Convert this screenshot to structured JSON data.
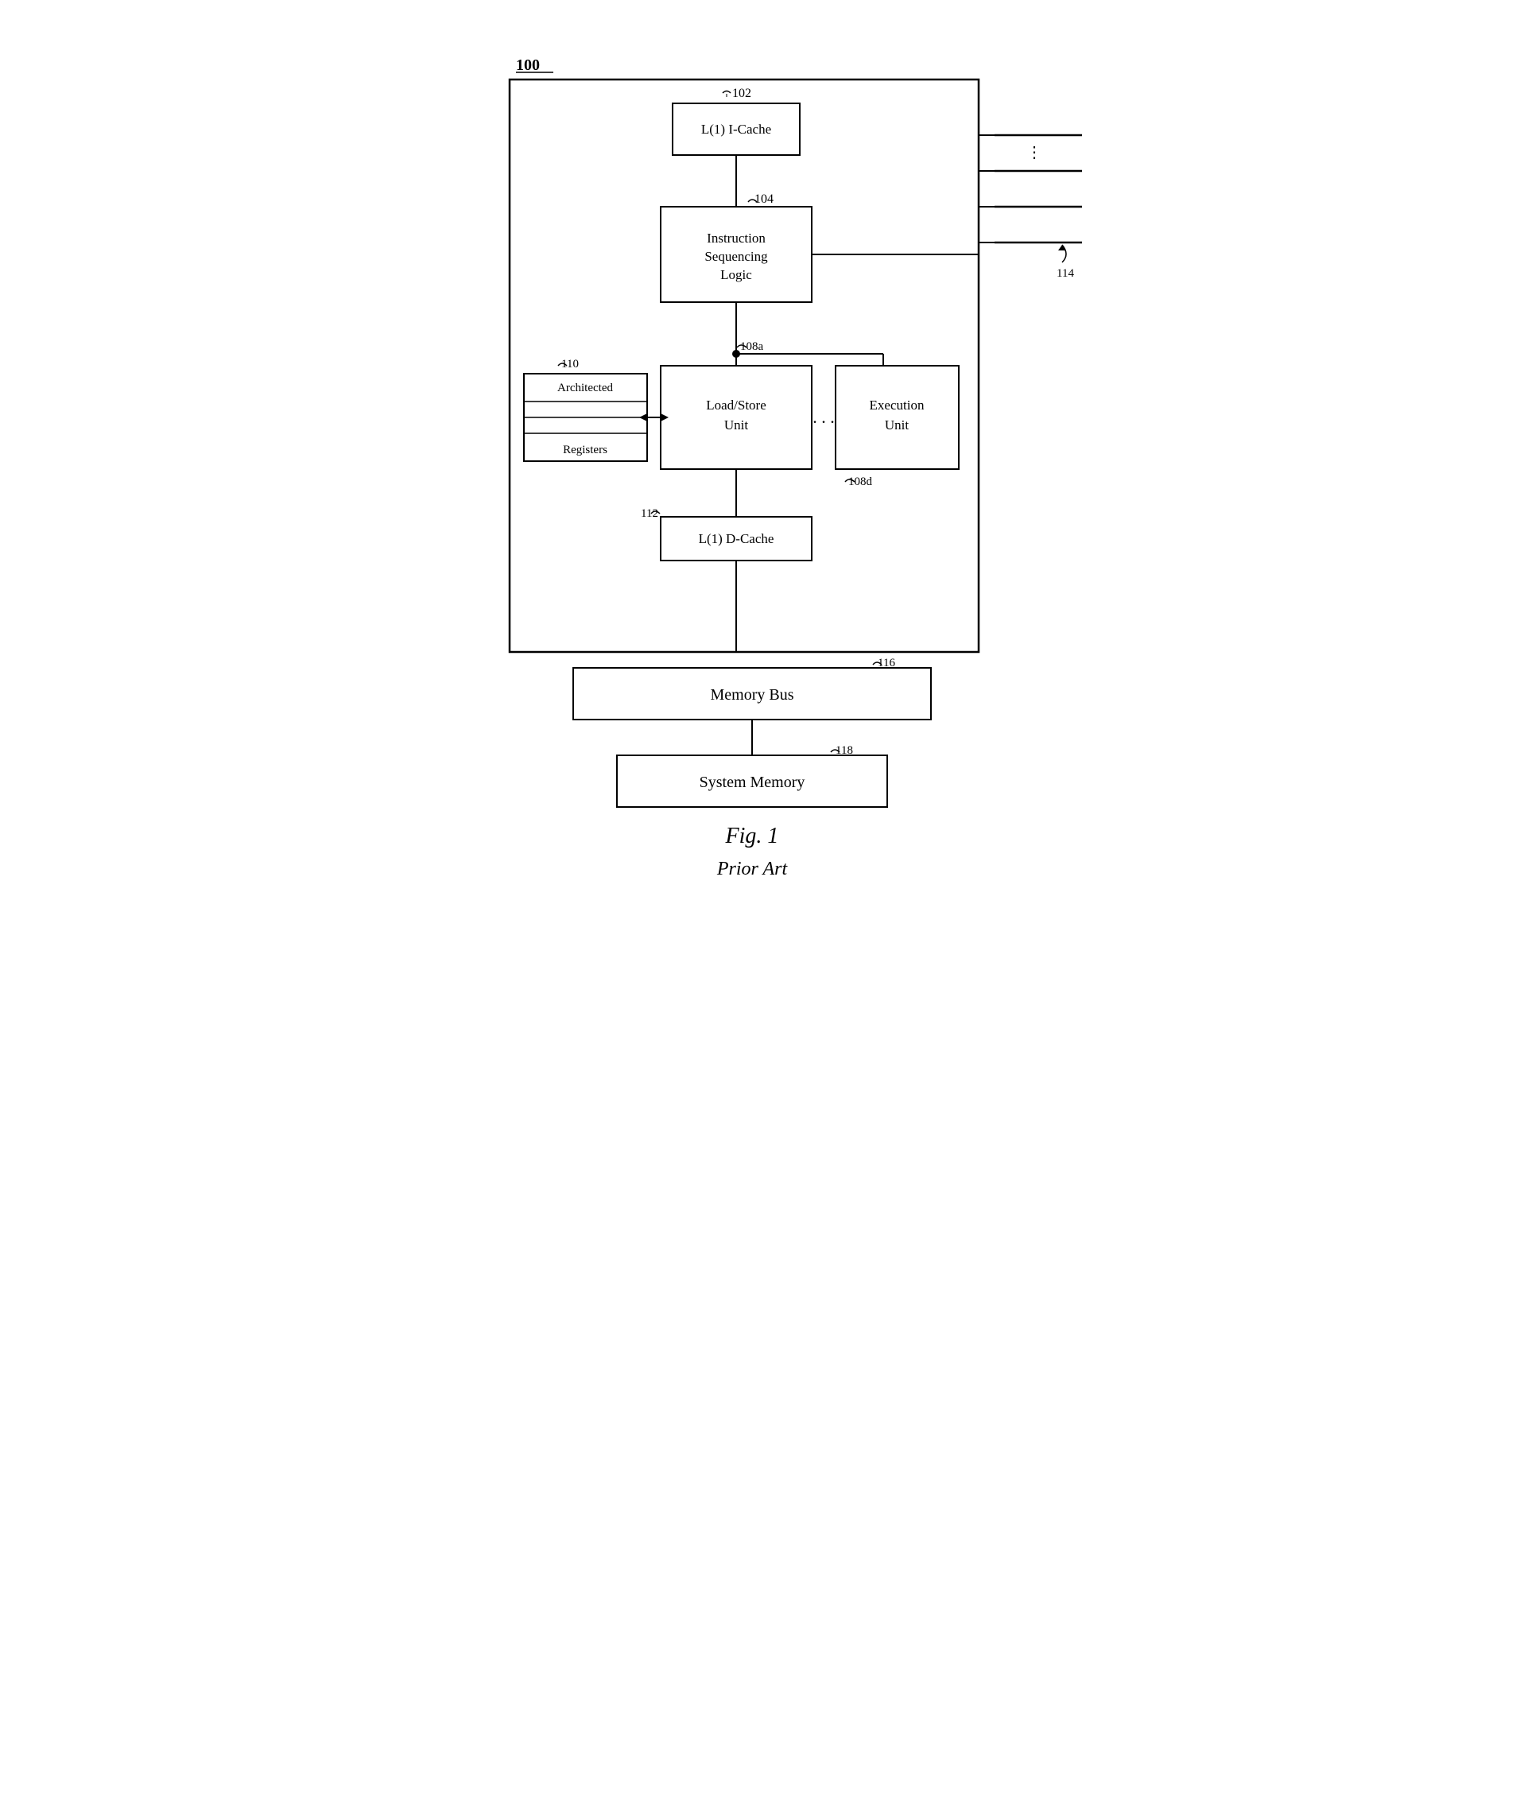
{
  "diagram": {
    "title": "100",
    "components": {
      "icache": {
        "label": "L(1) I-Cache",
        "ref": "102"
      },
      "isl": {
        "label": "Instruction\nSequencing\nLogic",
        "ref": "104"
      },
      "loadstore": {
        "label": "Load/Store\nUnit",
        "ref": "108a"
      },
      "execution": {
        "label": "Execution\nUnit",
        "ref": "108d"
      },
      "registers": {
        "label": "Architected\nRegisters",
        "ref": "110"
      },
      "dcache": {
        "label": "L(1) D-Cache",
        "ref": "112"
      },
      "membus": {
        "label": "Memory Bus",
        "ref": "116"
      },
      "sysmem": {
        "label": "System Memory",
        "ref": "118"
      }
    },
    "right_indicator": "114",
    "dots": "...",
    "caption": {
      "fig": "Fig. 1",
      "subtitle": "Prior Art"
    }
  }
}
